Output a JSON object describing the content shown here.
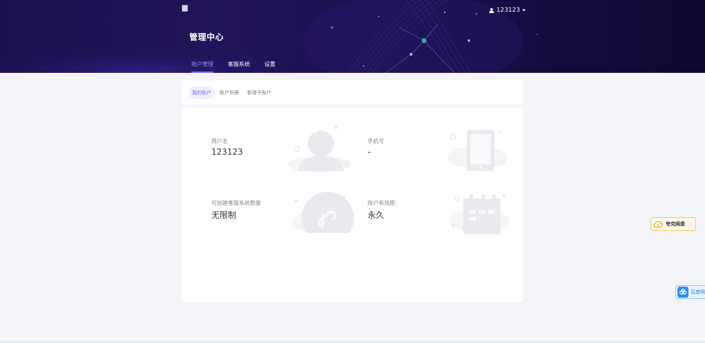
{
  "header": {
    "title": "管理中心",
    "user_name": "123123",
    "user_icon": "user-icon",
    "caret_icon": "caret-down-icon",
    "tabs": [
      {
        "label": "账户管理",
        "active": true
      },
      {
        "label": "客服系统",
        "active": false
      },
      {
        "label": "设置",
        "active": false
      }
    ]
  },
  "subtabs": [
    {
      "label": "我的账户",
      "active": true
    },
    {
      "label": "账户列表",
      "active": false
    },
    {
      "label": "新增子账户",
      "active": false
    }
  ],
  "account": {
    "username_label": "用户名",
    "username_value": "123123",
    "phone_label": "手机号",
    "phone_value": "-",
    "cs_count_label": "可创建客服系统数量",
    "cs_count_value": "无限制",
    "validity_label": "账户有效期",
    "validity_value": "永久"
  },
  "floating": {
    "quark_label": "夸克网盘",
    "baidu_label": "百度网"
  },
  "colors": {
    "header_bg": "#1c1150",
    "accent": "#7b6cff",
    "card_bg": "#ffffff",
    "page_bg": "#f3f5f8"
  }
}
